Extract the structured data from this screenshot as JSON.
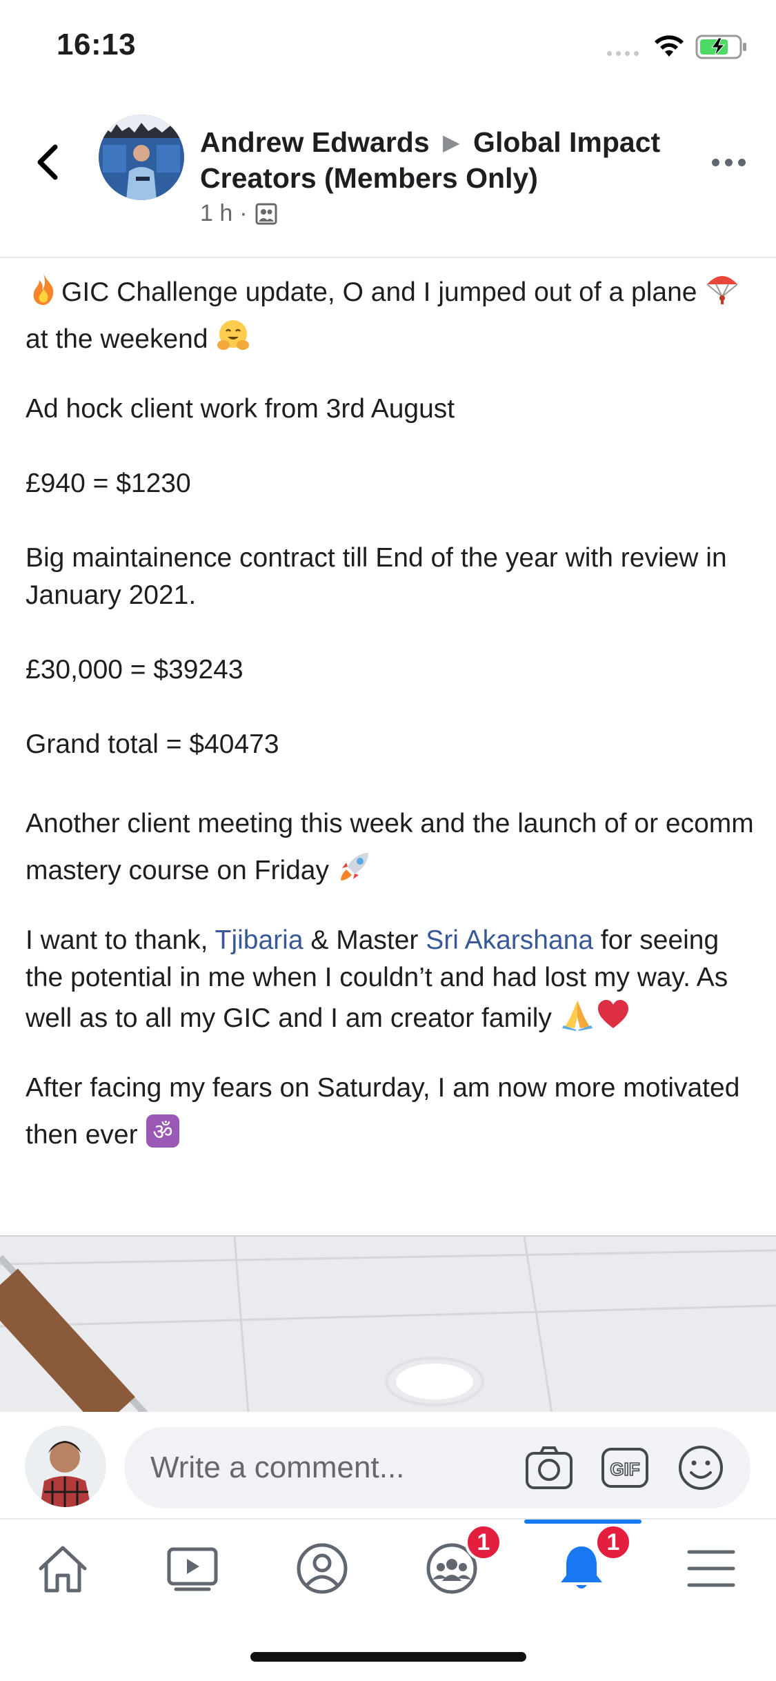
{
  "status_bar": {
    "time": "16:13"
  },
  "post_header": {
    "author": "Andrew Edwards",
    "group": "Global Impact Creators (Members Only)",
    "time_ago": "1 h",
    "separator": "·"
  },
  "post": {
    "paragraphs": {
      "p1_text_a": "GIC Challenge update, O and I jumped out of a plane",
      "p1_text_b": "at the weekend",
      "p2": "Ad hock client work from 3rd August",
      "p3": "£940 = $1230",
      "p4": "Big maintainence contract till End of the year with review in January 2021.",
      "p5": "£30,000 = $39243",
      "p6": "Grand total = $40473",
      "p7": "Another client meeting this week and the launch of or ecomm mastery course on Friday",
      "p8_a": "I want to thank,",
      "p8_link1": "Tjibaria",
      "p8_b": "& Master",
      "p8_link2": "Sri Akarshana",
      "p8_c": "for seeing the potential in me when I couldn’t and had lost my way. As well as to all my GIC and I am creator family",
      "p9": "After facing my fears on Saturday, I am now more motivated then ever"
    },
    "link_color": "#385898"
  },
  "comment_bar": {
    "placeholder": "Write a comment...",
    "icons": [
      "camera-icon",
      "gif-icon",
      "emoji-icon"
    ]
  },
  "tab_bar": {
    "tabs": [
      "home",
      "watch",
      "profile",
      "groups",
      "notifications",
      "menu"
    ],
    "groups_badge": "1",
    "notifications_badge": "1",
    "active_color": "#1877f2",
    "active_tab": "notifications"
  }
}
